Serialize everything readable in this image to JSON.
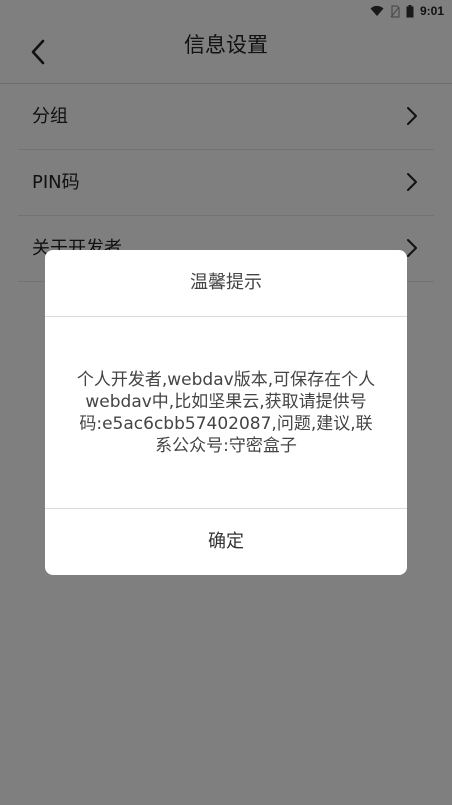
{
  "status_bar": {
    "time": "9:01",
    "icons": [
      "wifi-icon",
      "no-sim-icon",
      "battery-icon"
    ]
  },
  "app_bar": {
    "title": "信息设置",
    "back_icon": "chevron-left-icon"
  },
  "list": {
    "items": [
      {
        "label": "分组",
        "icon": "chevron-right-icon"
      },
      {
        "label": "PIN码",
        "icon": "chevron-right-icon"
      },
      {
        "label": "关于开发者",
        "icon": "chevron-right-icon"
      }
    ]
  },
  "dialog": {
    "title": "温馨提示",
    "message": "个人开发者,webdav版本,可保存在个人webdav中,比如坚果云,获取请提供号码:e5ac6cbb57402087,问题,建议,联系公众号:守密盒子",
    "ok_label": "确定"
  },
  "colors": {
    "overlay": "#000000",
    "text": "#222222",
    "divider": "#dcdcdc"
  }
}
